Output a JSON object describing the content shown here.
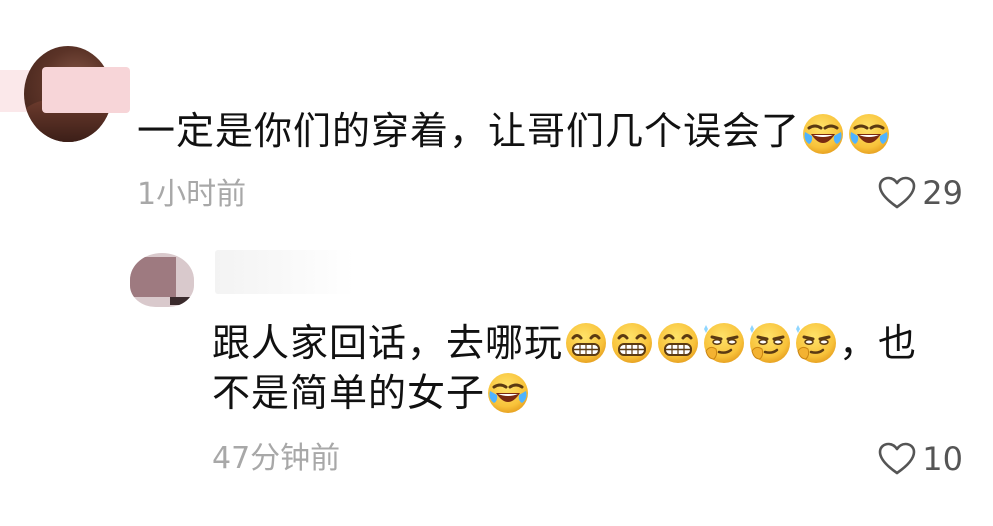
{
  "comment": {
    "text": "一定是你们的穿着，让哥们几个误会了",
    "emojis": [
      "laugh-cry-emoji",
      "laugh-cry-emoji"
    ],
    "time": "1小时前",
    "likes": "29",
    "reply": {
      "text_line1": "跟人家回话，去哪玩",
      "text_line1_end": "，也",
      "text_line2": "不是简单的女子",
      "emojis_line1": [
        "grin-emoji",
        "grin-emoji",
        "grin-emoji",
        "smirk-emoji",
        "smirk-emoji",
        "smirk-emoji"
      ],
      "emojis_line2": [
        "laugh-cry-emoji"
      ],
      "time": "47分钟前",
      "likes": "10"
    }
  },
  "colors": {
    "text": "#111111",
    "meta": "#a8a8a8",
    "emoji_yellow": "#f8c23a",
    "heart_outline": "#555555"
  }
}
